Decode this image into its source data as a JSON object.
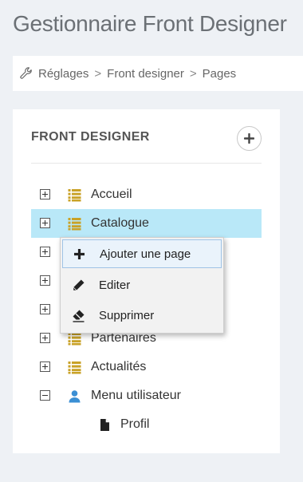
{
  "page": {
    "title": "Gestionnaire Front Designer"
  },
  "breadcrumb": {
    "items": [
      "Réglages",
      "Front designer",
      "Pages"
    ],
    "separator": ">"
  },
  "panel": {
    "title": "FRONT DESIGNER",
    "add_icon": "plus-circle-icon",
    "tree": [
      {
        "label": "Accueil",
        "toggle": "plus",
        "icon": "list-icon",
        "selected": false
      },
      {
        "label": "Catalogue",
        "toggle": "plus",
        "icon": "list-icon",
        "selected": true
      },
      {
        "label": "",
        "toggle": "plus",
        "icon": "list-icon",
        "selected": false
      },
      {
        "label": "",
        "toggle": "plus",
        "icon": "list-icon",
        "selected": false
      },
      {
        "label": "",
        "toggle": "plus",
        "icon": "list-icon",
        "selected": false
      },
      {
        "label": "Partenaires",
        "toggle": "plus",
        "icon": "list-icon",
        "selected": false
      },
      {
        "label": "Actualités",
        "toggle": "plus",
        "icon": "list-icon",
        "selected": false
      },
      {
        "label": "Menu utilisateur",
        "toggle": "minus",
        "icon": "user-icon",
        "selected": false,
        "children": [
          {
            "label": "Profil",
            "icon": "file-icon"
          }
        ]
      }
    ]
  },
  "context_menu": {
    "items": [
      {
        "label": "Ajouter une page",
        "icon": "plus-icon",
        "active": true
      },
      {
        "label": "Editer",
        "icon": "pencil-icon",
        "active": false
      },
      {
        "label": "Supprimer",
        "icon": "eraser-icon",
        "active": false
      }
    ]
  },
  "colors": {
    "background": "#eef1f5",
    "panel": "#ffffff",
    "selected_row": "#b9e8f8",
    "list_icon": "#c9a227",
    "user_icon": "#3b8fd4",
    "menu_background": "#f2f2f2",
    "menu_active": "#eaf3fb"
  }
}
